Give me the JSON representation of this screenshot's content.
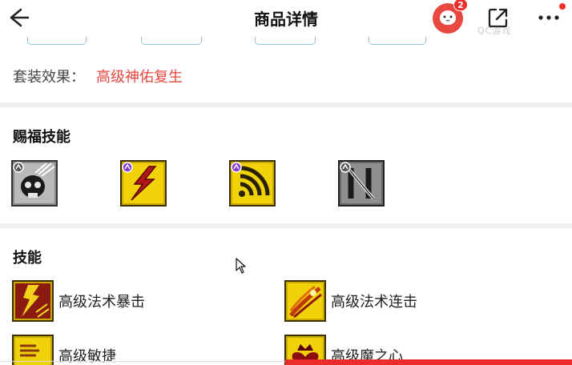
{
  "header": {
    "title": "商品详情",
    "notification_count": "2",
    "watermark": "QC游戏"
  },
  "set_effect": {
    "label": "套装效果：",
    "value": "高级神佑复生"
  },
  "blessing_skills": {
    "title": "赐福技能",
    "icons": [
      "skull-skill-icon",
      "lightning-skill-icon",
      "wave-skill-icon",
      "sword-skill-icon"
    ]
  },
  "skills": {
    "title": "技能",
    "items": [
      {
        "label": "高级法术暴击"
      },
      {
        "label": "高级法术连击"
      },
      {
        "label": "高级敏捷"
      },
      {
        "label": "高级魔之心"
      }
    ]
  },
  "colors": {
    "accent": "#e8483f",
    "badge": "#f02d2d",
    "icon_gold": "#e8c600",
    "icon_gray": "#7a7a7a"
  }
}
